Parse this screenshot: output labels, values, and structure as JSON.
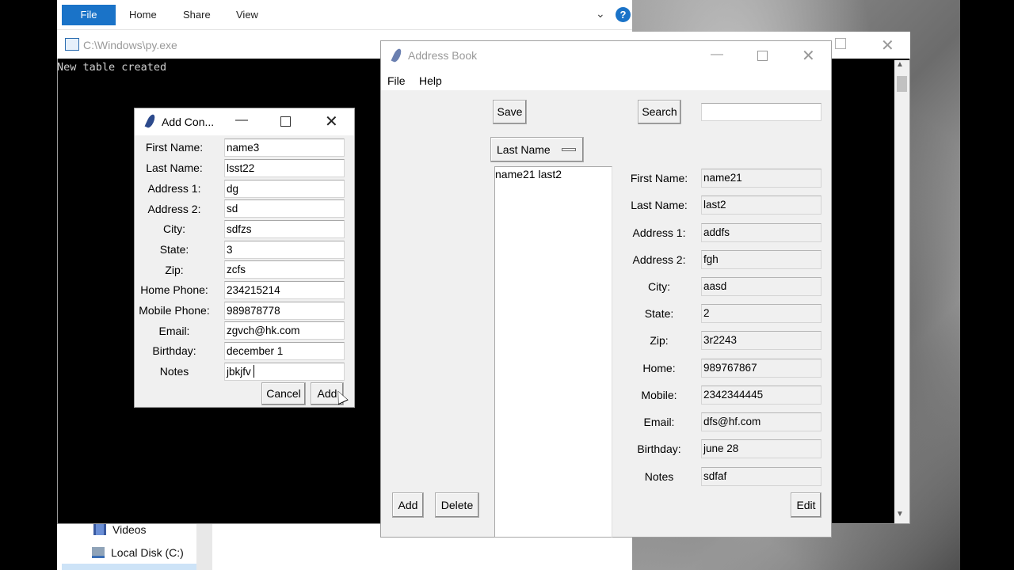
{
  "explorer": {
    "tabs": [
      "File",
      "Home",
      "Share",
      "View"
    ],
    "help": "?",
    "nav": [
      "Videos",
      "Local Disk (C:)"
    ]
  },
  "console": {
    "title": "C:\\Windows\\py.exe",
    "output": "New table created"
  },
  "add_contact": {
    "title": "Add Con...",
    "fields": [
      {
        "label": "First Name:",
        "value": "name3"
      },
      {
        "label": "Last Name:",
        "value": "lsst22"
      },
      {
        "label": "Address 1:",
        "value": "dg"
      },
      {
        "label": "Address 2:",
        "value": "sd"
      },
      {
        "label": "City:",
        "value": "sdfzs"
      },
      {
        "label": "State:",
        "value": "3"
      },
      {
        "label": "Zip:",
        "value": "zcfs"
      },
      {
        "label": "Home Phone:",
        "value": "234215214"
      },
      {
        "label": "Mobile Phone:",
        "value": "989878778"
      },
      {
        "label": "Email:",
        "value": "zgvch@hk.com"
      },
      {
        "label": "Birthday:",
        "value": "december 1"
      },
      {
        "label": "Notes",
        "value": "jbkjfv"
      }
    ],
    "cancel_label": "Cancel",
    "add_label": "Add"
  },
  "address_book": {
    "title": "Address Book",
    "menu": [
      "File",
      "Help"
    ],
    "save_label": "Save",
    "search_label": "Search",
    "search_value": "",
    "sort_label": "Last Name",
    "list": [
      "name21 last2"
    ],
    "details": [
      {
        "label": "First Name:",
        "value": "name21"
      },
      {
        "label": "Last Name:",
        "value": "last2"
      },
      {
        "label": "Address 1:",
        "value": "addfs"
      },
      {
        "label": "Address 2:",
        "value": "fgh"
      },
      {
        "label": "City:",
        "value": "aasd"
      },
      {
        "label": "State:",
        "value": "2"
      },
      {
        "label": "Zip:",
        "value": "3r2243"
      },
      {
        "label": "Home:",
        "value": "989767867"
      },
      {
        "label": "Mobile:",
        "value": "2342344445"
      },
      {
        "label": "Email:",
        "value": "dfs@hf.com"
      },
      {
        "label": "Birthday:",
        "value": "june 28"
      },
      {
        "label": "Notes",
        "value": "sdfaf"
      }
    ],
    "add_label": "Add",
    "delete_label": "Delete",
    "edit_label": "Edit"
  },
  "colors": {
    "ribbon_accent": "#1a73c8",
    "tk_background": "#f0f0f0",
    "console_background": "#000000"
  }
}
